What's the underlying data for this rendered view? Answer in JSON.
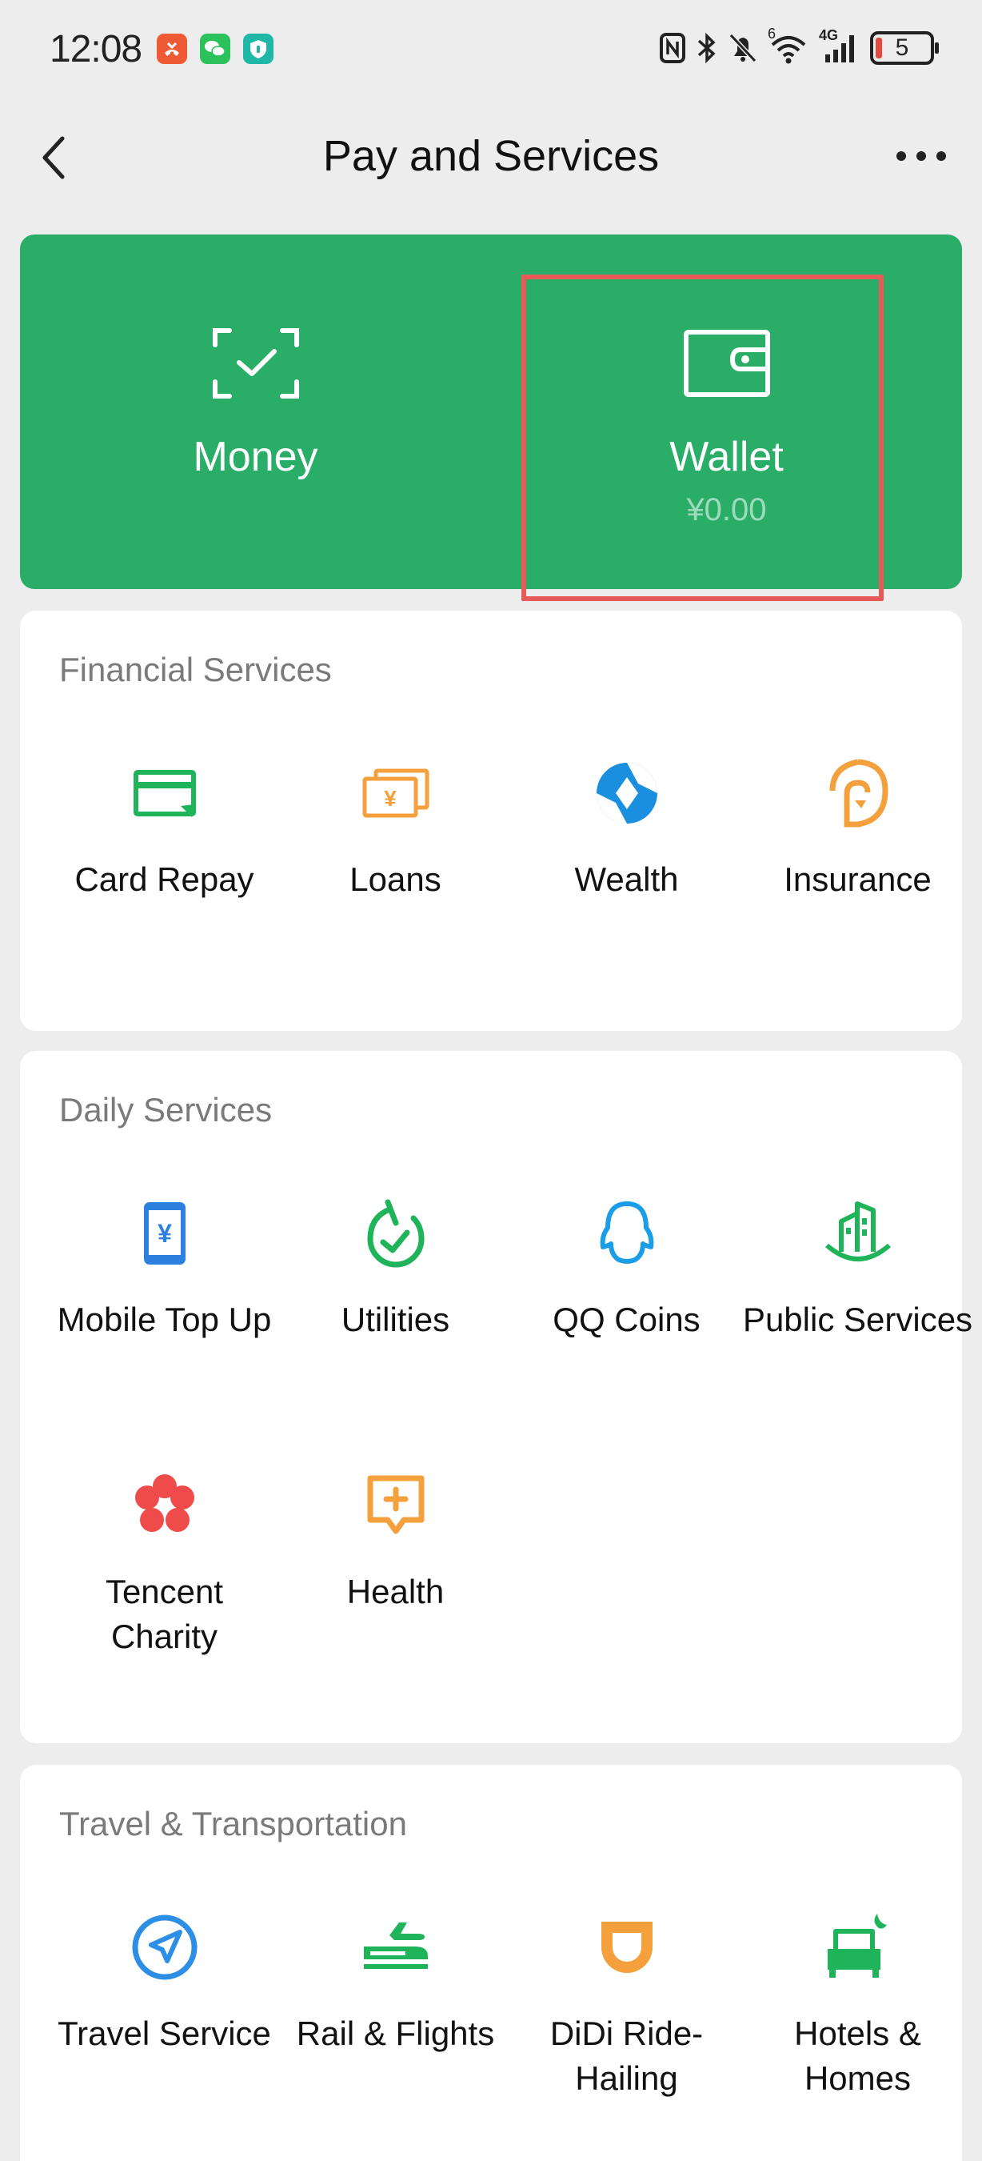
{
  "status_bar": {
    "time": "12:08",
    "network_label": "4G",
    "wifi_superscript": "6",
    "battery_level": "5"
  },
  "nav": {
    "title": "Pay and Services"
  },
  "top_card": {
    "money_label": "Money",
    "wallet_label": "Wallet",
    "wallet_balance": "¥0.00",
    "accent_color": "#2aae67",
    "highlight_color": "#e85a5a"
  },
  "financial": {
    "title": "Financial Services",
    "items": [
      {
        "label": "Card Repay",
        "icon": "card-repay-icon",
        "color": "#1fb35a"
      },
      {
        "label": "Loans",
        "icon": "loans-icon",
        "color": "#f4a03c"
      },
      {
        "label": "Wealth",
        "icon": "wealth-icon",
        "color": "#1a8fe0"
      },
      {
        "label": "Insurance",
        "icon": "insurance-icon",
        "color": "#f4a03c"
      }
    ]
  },
  "daily": {
    "title": "Daily Services",
    "items": [
      {
        "label": "Mobile Top Up",
        "icon": "mobile-top-up-icon",
        "color": "#2d7fe0"
      },
      {
        "label": "Utilities",
        "icon": "utilities-icon",
        "color": "#1fb35a"
      },
      {
        "label": "QQ Coins",
        "icon": "qq-coins-icon",
        "color": "#1a9ee8"
      },
      {
        "label": "Public Services",
        "icon": "public-services-icon",
        "color": "#1fb35a"
      },
      {
        "label": "Tencent Charity",
        "icon": "tencent-charity-icon",
        "color": "#ef4b4b"
      },
      {
        "label": "Health",
        "icon": "health-icon",
        "color": "#f4a03c"
      }
    ]
  },
  "travel": {
    "title": "Travel & Transportation",
    "items": [
      {
        "label": "Travel Service",
        "icon": "travel-service-icon",
        "color": "#2d8ee6"
      },
      {
        "label": "Rail & Flights",
        "icon": "rail-flights-icon",
        "color": "#1fb35a"
      },
      {
        "label": "DiDi Ride-Hailing",
        "icon": "didi-icon",
        "color": "#f4a03c"
      },
      {
        "label": "Hotels & Homes",
        "icon": "hotels-homes-icon",
        "color": "#1fb35a"
      }
    ]
  }
}
